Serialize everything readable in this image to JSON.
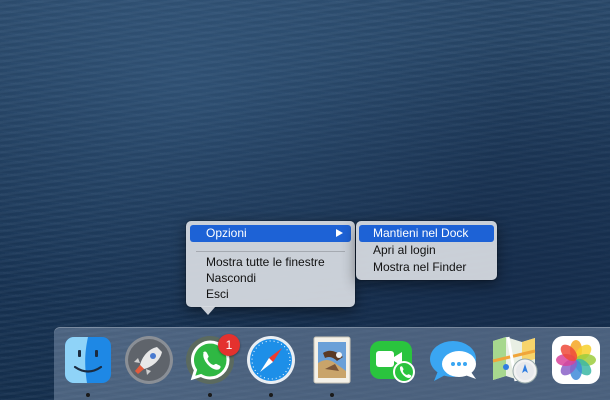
{
  "context_menu": {
    "items": [
      {
        "label": "Opzioni"
      },
      {
        "label": "Mostra tutte le finestre"
      },
      {
        "label": "Nascondi"
      },
      {
        "label": "Esci"
      }
    ]
  },
  "submenu": {
    "items": [
      {
        "label": "Mantieni nel Dock"
      },
      {
        "label": "Apri al login"
      },
      {
        "label": "Mostra nel Finder"
      }
    ]
  },
  "dock": {
    "items": [
      {
        "icon": "finder-icon",
        "running": true
      },
      {
        "icon": "launchpad-icon",
        "running": false
      },
      {
        "icon": "whatsapp-icon",
        "running": true,
        "badge": "1"
      },
      {
        "icon": "safari-icon",
        "running": true
      },
      {
        "icon": "mail-icon",
        "running": true
      },
      {
        "icon": "facetime-icon",
        "running": false
      },
      {
        "icon": "messages-icon",
        "running": false
      },
      {
        "icon": "maps-icon",
        "running": false
      },
      {
        "icon": "photos-icon",
        "running": false
      }
    ]
  },
  "colors": {
    "menu_highlight": "#1d62d6",
    "badge": "#e4312e"
  }
}
